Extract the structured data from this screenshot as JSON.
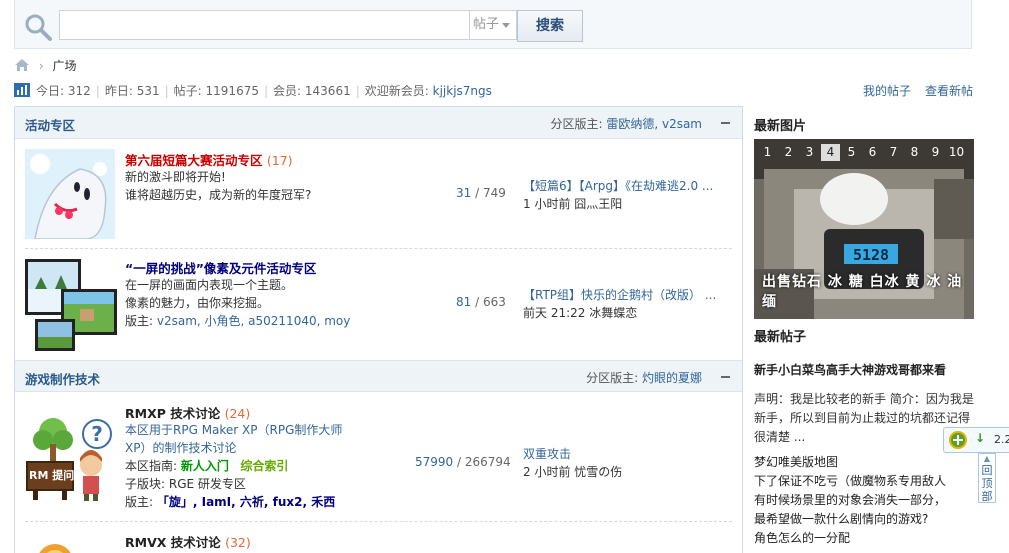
{
  "search": {
    "placeholder": "",
    "type_label": "帖子",
    "button_label": "搜索"
  },
  "breadcrumb": {
    "current": "广场"
  },
  "stats": {
    "today_label": "今日:",
    "today": "312",
    "yesterday_label": "昨日:",
    "yesterday": "531",
    "posts_label": "帖子:",
    "posts": "1191675",
    "members_label": "会员:",
    "members": "143661",
    "welcome_label": "欢迎新会员:",
    "newest_member": "kjjkjs7ngs"
  },
  "user_links": {
    "my_posts": "我的帖子",
    "new_posts": "查看新帖"
  },
  "categories": [
    {
      "title": "活动专区",
      "mods_label": "分区版主:",
      "mods": [
        "雷欧纳德",
        "v2sam"
      ],
      "mod_sep": ", ",
      "forums": [
        {
          "name": "第六届短篇大赛活动专区",
          "today": "(17)",
          "desc": [
            "新的激斗即将开始!",
            "谁将超越历史，成为新的年度冠军?"
          ],
          "threads": "31",
          "slash": " / ",
          "posts": "749",
          "last_title": "【短篇6】【Arpg】《在劫难逃2.0 ...",
          "last_time": "1 小时前",
          "last_user": "囧灬王阳"
        },
        {
          "name": "“一屏的挑战”像素及元件活动专区",
          "today": "",
          "desc": [
            "在一屏的画面内表现一个主题。",
            "像素的魅力，由你来挖掘。"
          ],
          "mods_label": "版主:",
          "mods": "v2sam, 小角色, a50211040, moy",
          "threads": "81",
          "slash": " / ",
          "posts": "663",
          "last_title": "【RTP组】快乐的企鹅村（改版） ...",
          "last_time": "前天 21:22",
          "last_user": "冰舞蝶恋"
        }
      ]
    },
    {
      "title": "游戏制作技术",
      "mods_label": "分区版主:",
      "mods": [
        "灼眼的夏娜"
      ],
      "forums": [
        {
          "name": "RMXP 技术讨论",
          "today": "(24)",
          "desc_link": [
            "本区用于RPG Maker XP（RPG制作大师",
            "XP）的制作技术讨论"
          ],
          "guide_label": "本区指南:",
          "guide_links": [
            "新人入门",
            "综合索引"
          ],
          "sub_label": "子版块:",
          "sub": "RGE 研发专区",
          "mods_label": "版主:",
          "mods": "「旋」, IamI, 六祈, fux2, 禾西",
          "icon_text": "RM 提问",
          "threads": "57990",
          "slash": " / ",
          "posts": "266794",
          "last_title": "双重攻击",
          "last_time": "2 小时前",
          "last_user": "忧雪の伤"
        },
        {
          "name": "RMVX 技术讨论",
          "today": "(32)"
        }
      ]
    }
  ],
  "sidebar": {
    "latest_images_title": "最新图片",
    "slider_pages": [
      "1",
      "2",
      "3",
      "4",
      "5",
      "6",
      "7",
      "8",
      "9",
      "10"
    ],
    "slider_active": 4,
    "slider_caption": "出售钻石 冰 糖 白冰 黄 冰 油 缅",
    "scale_reading": "5128",
    "latest_posts_title": "最新帖子",
    "hot_title": "新手小白菜鸟高手大神游戏哥都来看",
    "hot_summary": "声明：我是比较老的新手 简介：因为我是新手，所以到目前为止栽过的坑都还记得很清楚 ...",
    "items": [
      "梦幻唯美版地图",
      "下了保证不吃亏（做魔物系专用敌人",
      "有时候场景里的对象会消失一部分，",
      "最希望做一款什么剧情向的游戏?",
      "角色怎么的一分配"
    ]
  },
  "widgets": {
    "share_count": "2.2",
    "back_top": "回顶部"
  },
  "colors": {
    "link": "#336699",
    "forum_hot": "#cc0000",
    "forum_title": "#000080",
    "guide_link": "#009900",
    "header_bg": "#eef3f8"
  }
}
